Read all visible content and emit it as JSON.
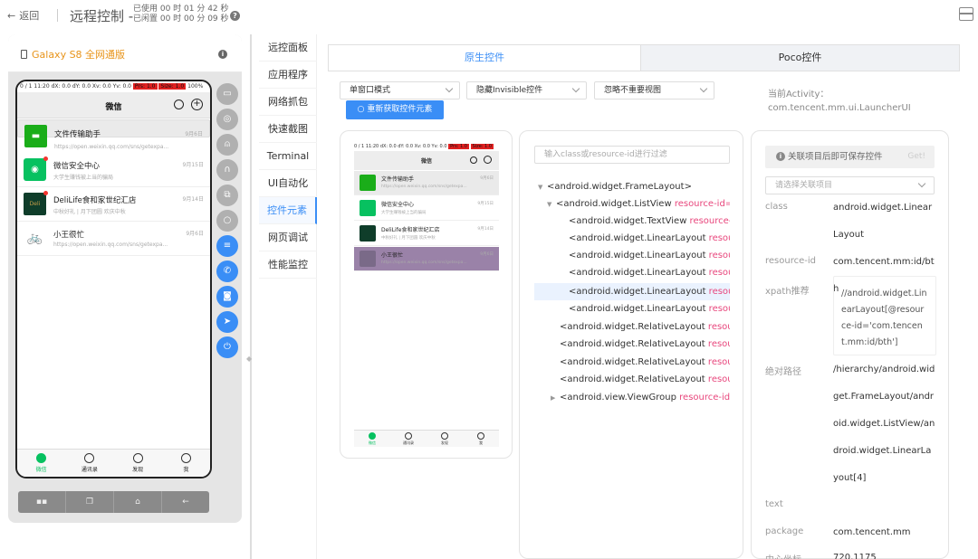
{
  "header": {
    "back_label": "返回",
    "title": "远程控制 -",
    "used_time": "已使用 00 时 01 分 42 秒",
    "idle_time": "已闲置 00 时 00 分 09 秒"
  },
  "device": {
    "name": "Galaxy S8 全网通版",
    "status_bar": "0 / 1  11:20  dX: 0.0  dY: 0.0  Xv: 0.0  Yv: 0.0",
    "status_prs": "Prs: 1.0",
    "status_size": "Size: 1.0",
    "battery": "100%",
    "wechat_title": "微信",
    "chats": [
      {
        "name": "文件传输助手",
        "sub": "https://open.weixin.qq.com/sns/getexpa...",
        "date": "9月6日"
      },
      {
        "name": "微信安全中心",
        "sub": "大学生赚钱被上当的骗局",
        "date": "9月15日"
      },
      {
        "name": "DeliLife食和家世纪汇店",
        "sub": "中秋好礼 | 月下团圆 欢庆中秋",
        "date": "9月14日"
      },
      {
        "name": "小王很忙",
        "sub": "https://open.weixin.qq.com/sns/getexpa...",
        "date": "9月6日"
      }
    ],
    "tabs": [
      "微信",
      "通讯录",
      "发现",
      "我"
    ],
    "nav_buttons": [
      "▪▪",
      "❐",
      "⌂",
      "←"
    ]
  },
  "menu": {
    "items": [
      "远控面板",
      "应用程序",
      "网络抓包",
      "快速截图",
      "Terminal",
      "UI自动化",
      "控件元素",
      "网页调试",
      "性能监控"
    ],
    "active": "控件元素"
  },
  "inspector": {
    "tab_native": "原生控件",
    "tab_poco": "Poco控件",
    "window_mode": "单窗口模式",
    "invisible_option": "隐藏Invisible控件",
    "ignore_option": "忽略不重要视图",
    "refresh_label": "重新获取控件元素",
    "activity_label": "当前Activity：",
    "activity_value": "com.tencent.mm.ui.LauncherUI",
    "filter_placeholder": "输入class或resource-id进行过滤",
    "tree": [
      {
        "text": "<android.widget.FrameLayout>",
        "attr": ""
      },
      {
        "text": "<android.widget.ListView ",
        "attr": "resource-id=\"c"
      },
      {
        "text": "<android.widget.TextView ",
        "attr": "resource-id"
      },
      {
        "text": "<android.widget.LinearLayout ",
        "attr": "resourc"
      },
      {
        "text": "<android.widget.LinearLayout ",
        "attr": "resourc"
      },
      {
        "text": "<android.widget.LinearLayout ",
        "attr": "resourc"
      },
      {
        "text": "<android.widget.LinearLayout ",
        "attr": "resourc"
      },
      {
        "text": "<android.widget.LinearLayout ",
        "attr": "resourc"
      },
      {
        "text": "<android.widget.RelativeLayout ",
        "attr": "resource"
      },
      {
        "text": "<android.widget.RelativeLayout ",
        "attr": "resource"
      },
      {
        "text": "<android.widget.RelativeLayout ",
        "attr": "resource"
      },
      {
        "text": "<android.widget.RelativeLayout ",
        "attr": "resource"
      },
      {
        "text": "<android.view.ViewGroup ",
        "attr": "resource-id=\""
      }
    ],
    "save_hint": "关联项目后即可保存控件",
    "get_label": "Get!",
    "project_placeholder": "请选择关联项目",
    "props": {
      "class_label": "class",
      "class_value": "android.widget.LinearLayout",
      "resid_label": "resource-id",
      "resid_value": "com.tencent.mm:id/bth",
      "xpath_label": "xpath推荐",
      "xpath_value": "//android.widget.LinearLayout[@resource-id='com.tencent.mm:id/bth']",
      "abspath_label": "绝对路径",
      "abspath_value": "/hierarchy/android.widget.FrameLayout/android.widget.ListView/android.widget.LinearLayout[4]",
      "text_label": "text",
      "package_label": "package",
      "package_value": "com.tencent.mm",
      "center_label": "中心坐标",
      "center_value": "720,1175"
    }
  }
}
